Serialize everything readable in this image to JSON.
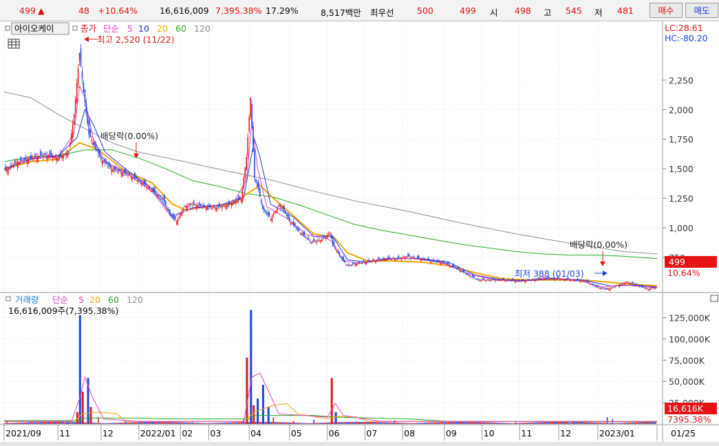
{
  "ticker": {
    "price": "499",
    "direction_symbol": "▲",
    "change": "48",
    "change_pct": "+10.64%",
    "volume": "16,616,009",
    "volume_ratio": "7,395.38%",
    "turnover_pct": "17.29%",
    "amount": "8,517백만",
    "best_bid_label": "최우선",
    "best_ask": "500",
    "best_bid": "499",
    "open_label": "시",
    "open": "498",
    "high_label": "고",
    "high": "545",
    "low_label": "저",
    "low": "481",
    "buy_label": "매수",
    "sell_label": "매도"
  },
  "legend": {
    "stock_name": "아이오케이",
    "close_label": "종가",
    "ma_label": "단순",
    "ma_periods": [
      "5",
      "10",
      "20",
      "60",
      "120"
    ],
    "volume_label": "거래량",
    "volume_readout": "16,616,009주(7,395.38%)"
  },
  "right_info": {
    "lc": "LC:28.61",
    "hc": "HC:-80.20"
  },
  "annotations": {
    "high_marker": "최고 2,520 (11/22)",
    "low_marker": "최저 388 (01/03)",
    "dividend_left": "배당락(0.00%)",
    "dividend_right": "배당락(0.00%)"
  },
  "price_badge": {
    "value": "499",
    "pct": "10.64%"
  },
  "volume_badge": {
    "value": "16,616K",
    "pct": "7395.38%"
  },
  "colors": {
    "up": "#e51414",
    "down": "#1c44e0",
    "ma5": "#e040c0",
    "ma10": "#1c33d9",
    "ma20": "#f2a600",
    "ma60": "#22a822",
    "ma120": "#8c8c8c"
  },
  "chart_data": {
    "type": "candlestick",
    "price_axis": {
      "ticks": [
        750,
        1000,
        1250,
        1500,
        1750,
        2000,
        2250
      ],
      "tick_labels": [
        "750",
        "1,000",
        "1,250",
        "1,500",
        "1,750",
        "2,000",
        "2,250"
      ],
      "range": [
        500,
        2700
      ]
    },
    "volume_axis": {
      "ticks": [
        25000,
        50000,
        75000,
        100000,
        125000
      ],
      "tick_labels": [
        "25,000K",
        "50,000K",
        "75,000K",
        "100,000K",
        "125,000K"
      ],
      "range": [
        0,
        140000
      ]
    },
    "x_labels": [
      "2021/09",
      "11",
      "12",
      "2022/01",
      "02",
      "03",
      "04",
      "05",
      "06",
      "07",
      "08",
      "09",
      "10",
      "11",
      "12",
      "2023/01",
      "01/25"
    ],
    "x_label_positions": [
      0,
      40,
      72,
      100,
      131,
      152,
      182,
      212,
      240,
      268,
      296,
      327,
      355,
      383,
      412,
      441,
      485
    ],
    "total_bars": 485,
    "close_series": [
      [
        0,
        1480
      ],
      [
        10,
        1560
      ],
      [
        20,
        1590
      ],
      [
        30,
        1620
      ],
      [
        40,
        1590
      ],
      [
        48,
        1640
      ],
      [
        52,
        1960
      ],
      [
        56,
        2480
      ],
      [
        59,
        2150
      ],
      [
        63,
        1790
      ],
      [
        67,
        1700
      ],
      [
        72,
        1580
      ],
      [
        80,
        1500
      ],
      [
        88,
        1470
      ],
      [
        96,
        1430
      ],
      [
        104,
        1370
      ],
      [
        112,
        1300
      ],
      [
        118,
        1240
      ],
      [
        123,
        1120
      ],
      [
        128,
        1050
      ],
      [
        134,
        1180
      ],
      [
        140,
        1200
      ],
      [
        148,
        1180
      ],
      [
        156,
        1170
      ],
      [
        166,
        1190
      ],
      [
        172,
        1230
      ],
      [
        176,
        1240
      ],
      [
        180,
        1600
      ],
      [
        183,
        2100
      ],
      [
        186,
        1420
      ],
      [
        189,
        1320
      ],
      [
        192,
        1160
      ],
      [
        198,
        1080
      ],
      [
        205,
        1200
      ],
      [
        212,
        1060
      ],
      [
        220,
        960
      ],
      [
        228,
        880
      ],
      [
        236,
        900
      ],
      [
        242,
        960
      ],
      [
        244,
        860
      ],
      [
        250,
        750
      ],
      [
        255,
        680
      ],
      [
        262,
        700
      ],
      [
        272,
        720
      ],
      [
        282,
        740
      ],
      [
        292,
        740
      ],
      [
        300,
        760
      ],
      [
        308,
        740
      ],
      [
        318,
        720
      ],
      [
        328,
        700
      ],
      [
        336,
        660
      ],
      [
        345,
        600
      ],
      [
        352,
        560
      ],
      [
        362,
        560
      ],
      [
        372,
        560
      ],
      [
        382,
        550
      ],
      [
        392,
        560
      ],
      [
        400,
        580
      ],
      [
        410,
        570
      ],
      [
        420,
        560
      ],
      [
        432,
        550
      ],
      [
        440,
        500
      ],
      [
        448,
        480
      ],
      [
        455,
        510
      ],
      [
        462,
        540
      ],
      [
        470,
        520
      ],
      [
        478,
        480
      ],
      [
        485,
        499
      ]
    ],
    "volume_series": [
      [
        2,
        4000
      ],
      [
        20,
        3000
      ],
      [
        45,
        2000
      ],
      [
        54,
        14000
      ],
      [
        56,
        128000
      ],
      [
        58,
        38000
      ],
      [
        62,
        54000
      ],
      [
        64,
        20000
      ],
      [
        70,
        8000
      ],
      [
        90,
        3500
      ],
      [
        110,
        2500
      ],
      [
        140,
        2000
      ],
      [
        178,
        6000
      ],
      [
        180,
        78000
      ],
      [
        183,
        134000
      ],
      [
        185,
        22000
      ],
      [
        188,
        30000
      ],
      [
        192,
        46000
      ],
      [
        196,
        20000
      ],
      [
        200,
        8000
      ],
      [
        215,
        3500
      ],
      [
        230,
        5000
      ],
      [
        243,
        54000
      ],
      [
        246,
        14000
      ],
      [
        262,
        3000
      ],
      [
        290,
        4500
      ],
      [
        325,
        3500
      ],
      [
        350,
        2500
      ],
      [
        380,
        2000
      ],
      [
        420,
        1500
      ],
      [
        448,
        8000
      ],
      [
        452,
        6000
      ],
      [
        485,
        16616
      ]
    ],
    "ma120_series": [
      [
        0,
        2150
      ],
      [
        20,
        2100
      ],
      [
        40,
        1960
      ],
      [
        60,
        1840
      ],
      [
        80,
        1720
      ],
      [
        100,
        1640
      ],
      [
        130,
        1570
      ],
      [
        170,
        1470
      ],
      [
        200,
        1400
      ],
      [
        230,
        1310
      ],
      [
        260,
        1230
      ],
      [
        300,
        1140
      ],
      [
        340,
        1040
      ],
      [
        380,
        950
      ],
      [
        420,
        870
      ],
      [
        460,
        800
      ],
      [
        485,
        780
      ]
    ],
    "ma60_series": [
      [
        0,
        1560
      ],
      [
        20,
        1600
      ],
      [
        40,
        1610
      ],
      [
        60,
        1660
      ],
      [
        80,
        1660
      ],
      [
        100,
        1590
      ],
      [
        120,
        1500
      ],
      [
        140,
        1400
      ],
      [
        160,
        1350
      ],
      [
        180,
        1290
      ],
      [
        200,
        1260
      ],
      [
        220,
        1190
      ],
      [
        240,
        1110
      ],
      [
        260,
        1030
      ],
      [
        280,
        980
      ],
      [
        300,
        940
      ],
      [
        320,
        900
      ],
      [
        340,
        860
      ],
      [
        360,
        830
      ],
      [
        380,
        800
      ],
      [
        400,
        780
      ],
      [
        420,
        770
      ],
      [
        440,
        770
      ],
      [
        460,
        760
      ],
      [
        485,
        740
      ]
    ],
    "ma20_series": [
      [
        0,
        1500
      ],
      [
        20,
        1560
      ],
      [
        40,
        1580
      ],
      [
        56,
        1720
      ],
      [
        70,
        1660
      ],
      [
        90,
        1480
      ],
      [
        110,
        1380
      ],
      [
        125,
        1200
      ],
      [
        135,
        1150
      ],
      [
        150,
        1180
      ],
      [
        170,
        1200
      ],
      [
        182,
        1300
      ],
      [
        190,
        1360
      ],
      [
        200,
        1250
      ],
      [
        215,
        1100
      ],
      [
        230,
        950
      ],
      [
        245,
        920
      ],
      [
        255,
        790
      ],
      [
        270,
        720
      ],
      [
        290,
        720
      ],
      [
        310,
        710
      ],
      [
        330,
        680
      ],
      [
        350,
        620
      ],
      [
        370,
        570
      ],
      [
        390,
        560
      ],
      [
        410,
        560
      ],
      [
        430,
        560
      ],
      [
        450,
        540
      ],
      [
        470,
        520
      ],
      [
        485,
        510
      ]
    ],
    "ma5_series": [
      [
        0,
        1480
      ],
      [
        20,
        1590
      ],
      [
        40,
        1600
      ],
      [
        52,
        1800
      ],
      [
        56,
        2200
      ],
      [
        60,
        2100
      ],
      [
        66,
        1760
      ],
      [
        75,
        1560
      ],
      [
        90,
        1470
      ],
      [
        110,
        1310
      ],
      [
        125,
        1080
      ],
      [
        135,
        1150
      ],
      [
        150,
        1180
      ],
      [
        170,
        1210
      ],
      [
        180,
        1400
      ],
      [
        184,
        1900
      ],
      [
        188,
        1520
      ],
      [
        195,
        1180
      ],
      [
        210,
        1080
      ],
      [
        225,
        940
      ],
      [
        240,
        910
      ],
      [
        244,
        880
      ],
      [
        252,
        720
      ],
      [
        265,
        700
      ],
      [
        285,
        740
      ],
      [
        305,
        740
      ],
      [
        325,
        710
      ],
      [
        345,
        610
      ],
      [
        365,
        560
      ],
      [
        385,
        550
      ],
      [
        405,
        575
      ],
      [
        425,
        560
      ],
      [
        445,
        500
      ],
      [
        460,
        520
      ],
      [
        475,
        500
      ],
      [
        485,
        495
      ]
    ],
    "ma10_series": [
      [
        0,
        1500
      ],
      [
        20,
        1580
      ],
      [
        40,
        1610
      ],
      [
        54,
        1760
      ],
      [
        60,
        2000
      ],
      [
        66,
        1880
      ],
      [
        75,
        1640
      ],
      [
        90,
        1500
      ],
      [
        110,
        1330
      ],
      [
        125,
        1100
      ],
      [
        140,
        1170
      ],
      [
        160,
        1190
      ],
      [
        178,
        1260
      ],
      [
        186,
        1750
      ],
      [
        190,
        1600
      ],
      [
        198,
        1200
      ],
      [
        215,
        1090
      ],
      [
        230,
        930
      ],
      [
        244,
        930
      ],
      [
        255,
        730
      ],
      [
        270,
        710
      ],
      [
        290,
        740
      ],
      [
        310,
        740
      ],
      [
        330,
        710
      ],
      [
        350,
        600
      ],
      [
        370,
        560
      ],
      [
        390,
        555
      ],
      [
        410,
        570
      ],
      [
        430,
        560
      ],
      [
        450,
        510
      ],
      [
        470,
        515
      ],
      [
        485,
        500
      ]
    ],
    "vol_ma5_series": [
      [
        0,
        3000
      ],
      [
        50,
        3000
      ],
      [
        56,
        30000
      ],
      [
        60,
        55000
      ],
      [
        66,
        30000
      ],
      [
        74,
        6000
      ],
      [
        100,
        3000
      ],
      [
        178,
        3000
      ],
      [
        184,
        55000
      ],
      [
        190,
        60000
      ],
      [
        196,
        40000
      ],
      [
        204,
        12000
      ],
      [
        240,
        8000
      ],
      [
        246,
        24000
      ],
      [
        252,
        10000
      ],
      [
        280,
        3000
      ],
      [
        485,
        3000
      ]
    ],
    "vol_ma20_series": [
      [
        0,
        3000
      ],
      [
        52,
        3000
      ],
      [
        58,
        12000
      ],
      [
        70,
        14000
      ],
      [
        84,
        12000
      ],
      [
        90,
        3000
      ],
      [
        178,
        3000
      ],
      [
        186,
        14000
      ],
      [
        200,
        22000
      ],
      [
        210,
        24000
      ],
      [
        218,
        12000
      ],
      [
        240,
        6000
      ],
      [
        248,
        9000
      ],
      [
        262,
        8000
      ],
      [
        270,
        3000
      ],
      [
        485,
        3000
      ]
    ],
    "vol_ma60_series": [
      [
        0,
        4000
      ],
      [
        56,
        4000
      ],
      [
        60,
        7000
      ],
      [
        100,
        7000
      ],
      [
        120,
        6000
      ],
      [
        182,
        6000
      ],
      [
        186,
        10000
      ],
      [
        230,
        10000
      ],
      [
        246,
        8000
      ],
      [
        300,
        6000
      ],
      [
        330,
        3000
      ],
      [
        485,
        2500
      ]
    ]
  }
}
